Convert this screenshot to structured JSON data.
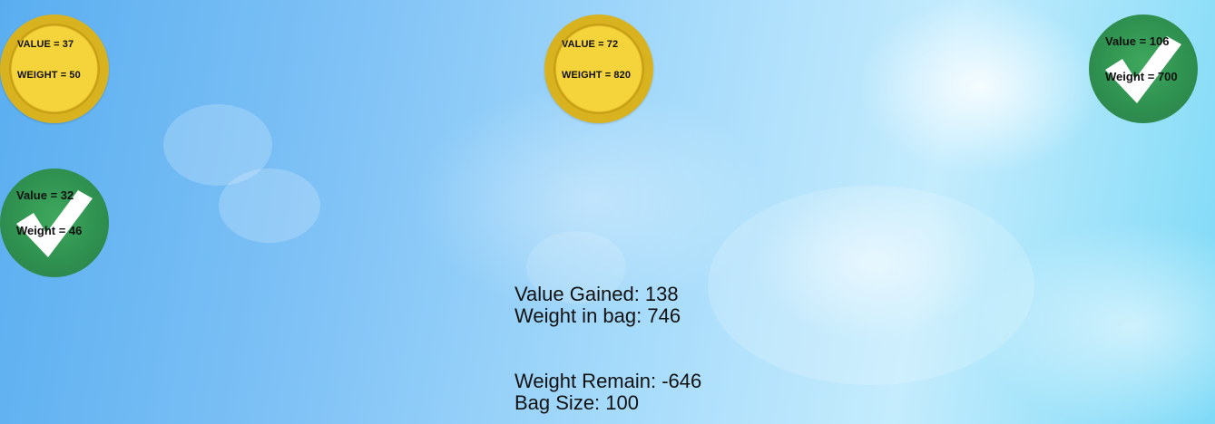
{
  "tokens": [
    {
      "type": "gold",
      "value_text": "VALUE = 37",
      "weight_text": "WEIGHT = 50"
    },
    {
      "type": "gold",
      "value_text": "VALUE = 72",
      "weight_text": "WEIGHT = 820"
    },
    {
      "type": "green",
      "value_text": "Value = 106",
      "weight_text": "Weight = 700"
    },
    {
      "type": "green",
      "value_text": "Value = 32",
      "weight_text": "Weight = 46"
    }
  ],
  "stats": {
    "value_gained": "Value Gained: 138",
    "weight_in_bag": "Weight in bag: 746",
    "weight_remain": "Weight Remain: -646",
    "bag_size": "Bag Size: 100"
  }
}
